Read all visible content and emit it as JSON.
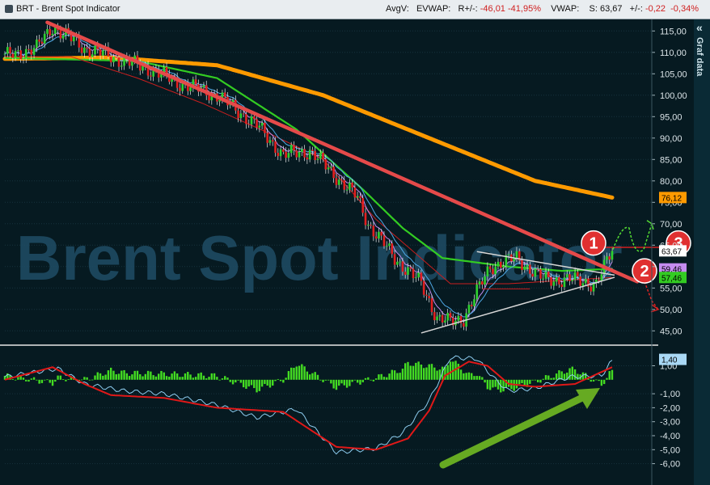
{
  "header": {
    "title": "BRT - Brent Spot Indicator",
    "avgv": "AvgV:",
    "evwap": "EVWAP:",
    "r_label": "R+/-:",
    "r_value": "-46,01",
    "r_pct": "-41,95%",
    "vwap": "VWAP:",
    "s_label": "S:",
    "s_value": "63,67",
    "pm_label": "+/-:",
    "pm_value": "-0,22",
    "pm_pct": "-0,34%"
  },
  "sidebar": {
    "label": "Graf data",
    "chevron": "«"
  },
  "watermark": "Brent Spot Indicator",
  "colors": {
    "background": "#061a21",
    "up_candle": "#2fd12f",
    "down_candle": "#e12020",
    "ma_orange": "#ff9a00",
    "ma_green": "#33cc22",
    "ma_red": "#c81e1e",
    "ma_purple": "#c58cf0",
    "ma_blue": "#4fa9e6",
    "trendline": "#e54a4a",
    "triangle": "#d8d8d8",
    "macd_hist": "#44dd22",
    "annotation_arrow": "#66aa22"
  },
  "chart_data": [
    {
      "type": "candlestick",
      "title": "BRT - Brent Spot Indicator",
      "ylim": [
        41,
        118
      ],
      "y_ticks": [
        "115,00",
        "110,00",
        "105,00",
        "100,00",
        "95,00",
        "90,00",
        "85,00",
        "80,00",
        "75,00",
        "70,00",
        "65,00",
        "60,00",
        "55,00",
        "50,00",
        "45,00"
      ],
      "close_anchors": [
        [
          0,
          109
        ],
        [
          12,
          111
        ],
        [
          18,
          116
        ],
        [
          30,
          111
        ],
        [
          45,
          108
        ],
        [
          55,
          106
        ],
        [
          65,
          103
        ],
        [
          80,
          100
        ],
        [
          95,
          93
        ],
        [
          105,
          86
        ],
        [
          115,
          87
        ],
        [
          125,
          81
        ],
        [
          133,
          76
        ],
        [
          137,
          70
        ],
        [
          147,
          62
        ],
        [
          157,
          56
        ],
        [
          163,
          48
        ],
        [
          168,
          47
        ],
        [
          173,
          48
        ],
        [
          183,
          60
        ],
        [
          193,
          62
        ],
        [
          203,
          57
        ],
        [
          213,
          57
        ],
        [
          223,
          56
        ],
        [
          227,
          61
        ],
        [
          229,
          63.67
        ]
      ],
      "moving_averages": [
        {
          "name": "MA orange",
          "values": [
            [
              0,
              108.5
            ],
            [
              40,
              108.8
            ],
            [
              80,
              107
            ],
            [
              120,
              100
            ],
            [
              160,
              90
            ],
            [
              200,
              80
            ],
            [
              229,
              76.12
            ]
          ]
        },
        {
          "name": "MA green",
          "values": [
            [
              0,
              108.7
            ],
            [
              50,
              108
            ],
            [
              80,
              104
            ],
            [
              110,
              92
            ],
            [
              135,
              78
            ],
            [
              150,
              69
            ],
            [
              165,
              62
            ],
            [
              190,
              60
            ],
            [
              210,
              59
            ],
            [
              229,
              59.46
            ]
          ]
        },
        {
          "name": "MA red",
          "values": [
            [
              0,
              109
            ],
            [
              25,
              109
            ],
            [
              50,
              104
            ],
            [
              75,
              98
            ],
            [
              100,
              91
            ],
            [
              120,
              85
            ],
            [
              140,
              71
            ],
            [
              155,
              63
            ],
            [
              168,
              56
            ],
            [
              190,
              56
            ],
            [
              229,
              57.46
            ]
          ]
        }
      ],
      "price_tags": [
        {
          "label": "76,12",
          "value": 76.12,
          "color": "#ff9a00"
        },
        {
          "label": "63,67",
          "value": 63.67,
          "color": "#ffffff"
        },
        {
          "label": "59,46",
          "value": 59.46,
          "color": "#c58cf0"
        },
        {
          "label": "57,46",
          "value": 57.46,
          "color": "#33cc22"
        }
      ],
      "annotations": [
        "1",
        "2",
        "3"
      ]
    },
    {
      "type": "macd",
      "ylim": [
        -6.6,
        2.6
      ],
      "y_ticks": [
        "1,00",
        "-1,00",
        "-2,00",
        "-3,00",
        "-4,00",
        "-5,00",
        "-6,00"
      ],
      "last_value_label": "1,40",
      "last_value": 1.4,
      "macd_anchors": [
        [
          0,
          0.2
        ],
        [
          20,
          0.8
        ],
        [
          30,
          -0.3
        ],
        [
          45,
          -0.8
        ],
        [
          60,
          -1.0
        ],
        [
          80,
          -1.8
        ],
        [
          95,
          -2.7
        ],
        [
          110,
          -2.1
        ],
        [
          125,
          -5.2
        ],
        [
          140,
          -4.9
        ],
        [
          150,
          -3.8
        ],
        [
          160,
          -1.5
        ],
        [
          168,
          1.6
        ],
        [
          178,
          1.5
        ],
        [
          185,
          0
        ],
        [
          190,
          -0.8
        ],
        [
          200,
          -0.6
        ],
        [
          213,
          0.2
        ],
        [
          225,
          0.3
        ],
        [
          229,
          1.4
        ]
      ],
      "signal_anchors": [
        [
          0,
          0.0
        ],
        [
          18,
          0.9
        ],
        [
          30,
          -0.3
        ],
        [
          40,
          -1.1
        ],
        [
          60,
          -1.3
        ],
        [
          80,
          -2.0
        ],
        [
          105,
          -2.3
        ],
        [
          125,
          -4.8
        ],
        [
          140,
          -5.0
        ],
        [
          152,
          -4.2
        ],
        [
          160,
          -2.2
        ],
        [
          166,
          0.3
        ],
        [
          175,
          1.3
        ],
        [
          182,
          1.0
        ],
        [
          190,
          -0.3
        ],
        [
          200,
          -0.5
        ],
        [
          215,
          -0.3
        ],
        [
          229,
          0.9
        ]
      ]
    }
  ]
}
